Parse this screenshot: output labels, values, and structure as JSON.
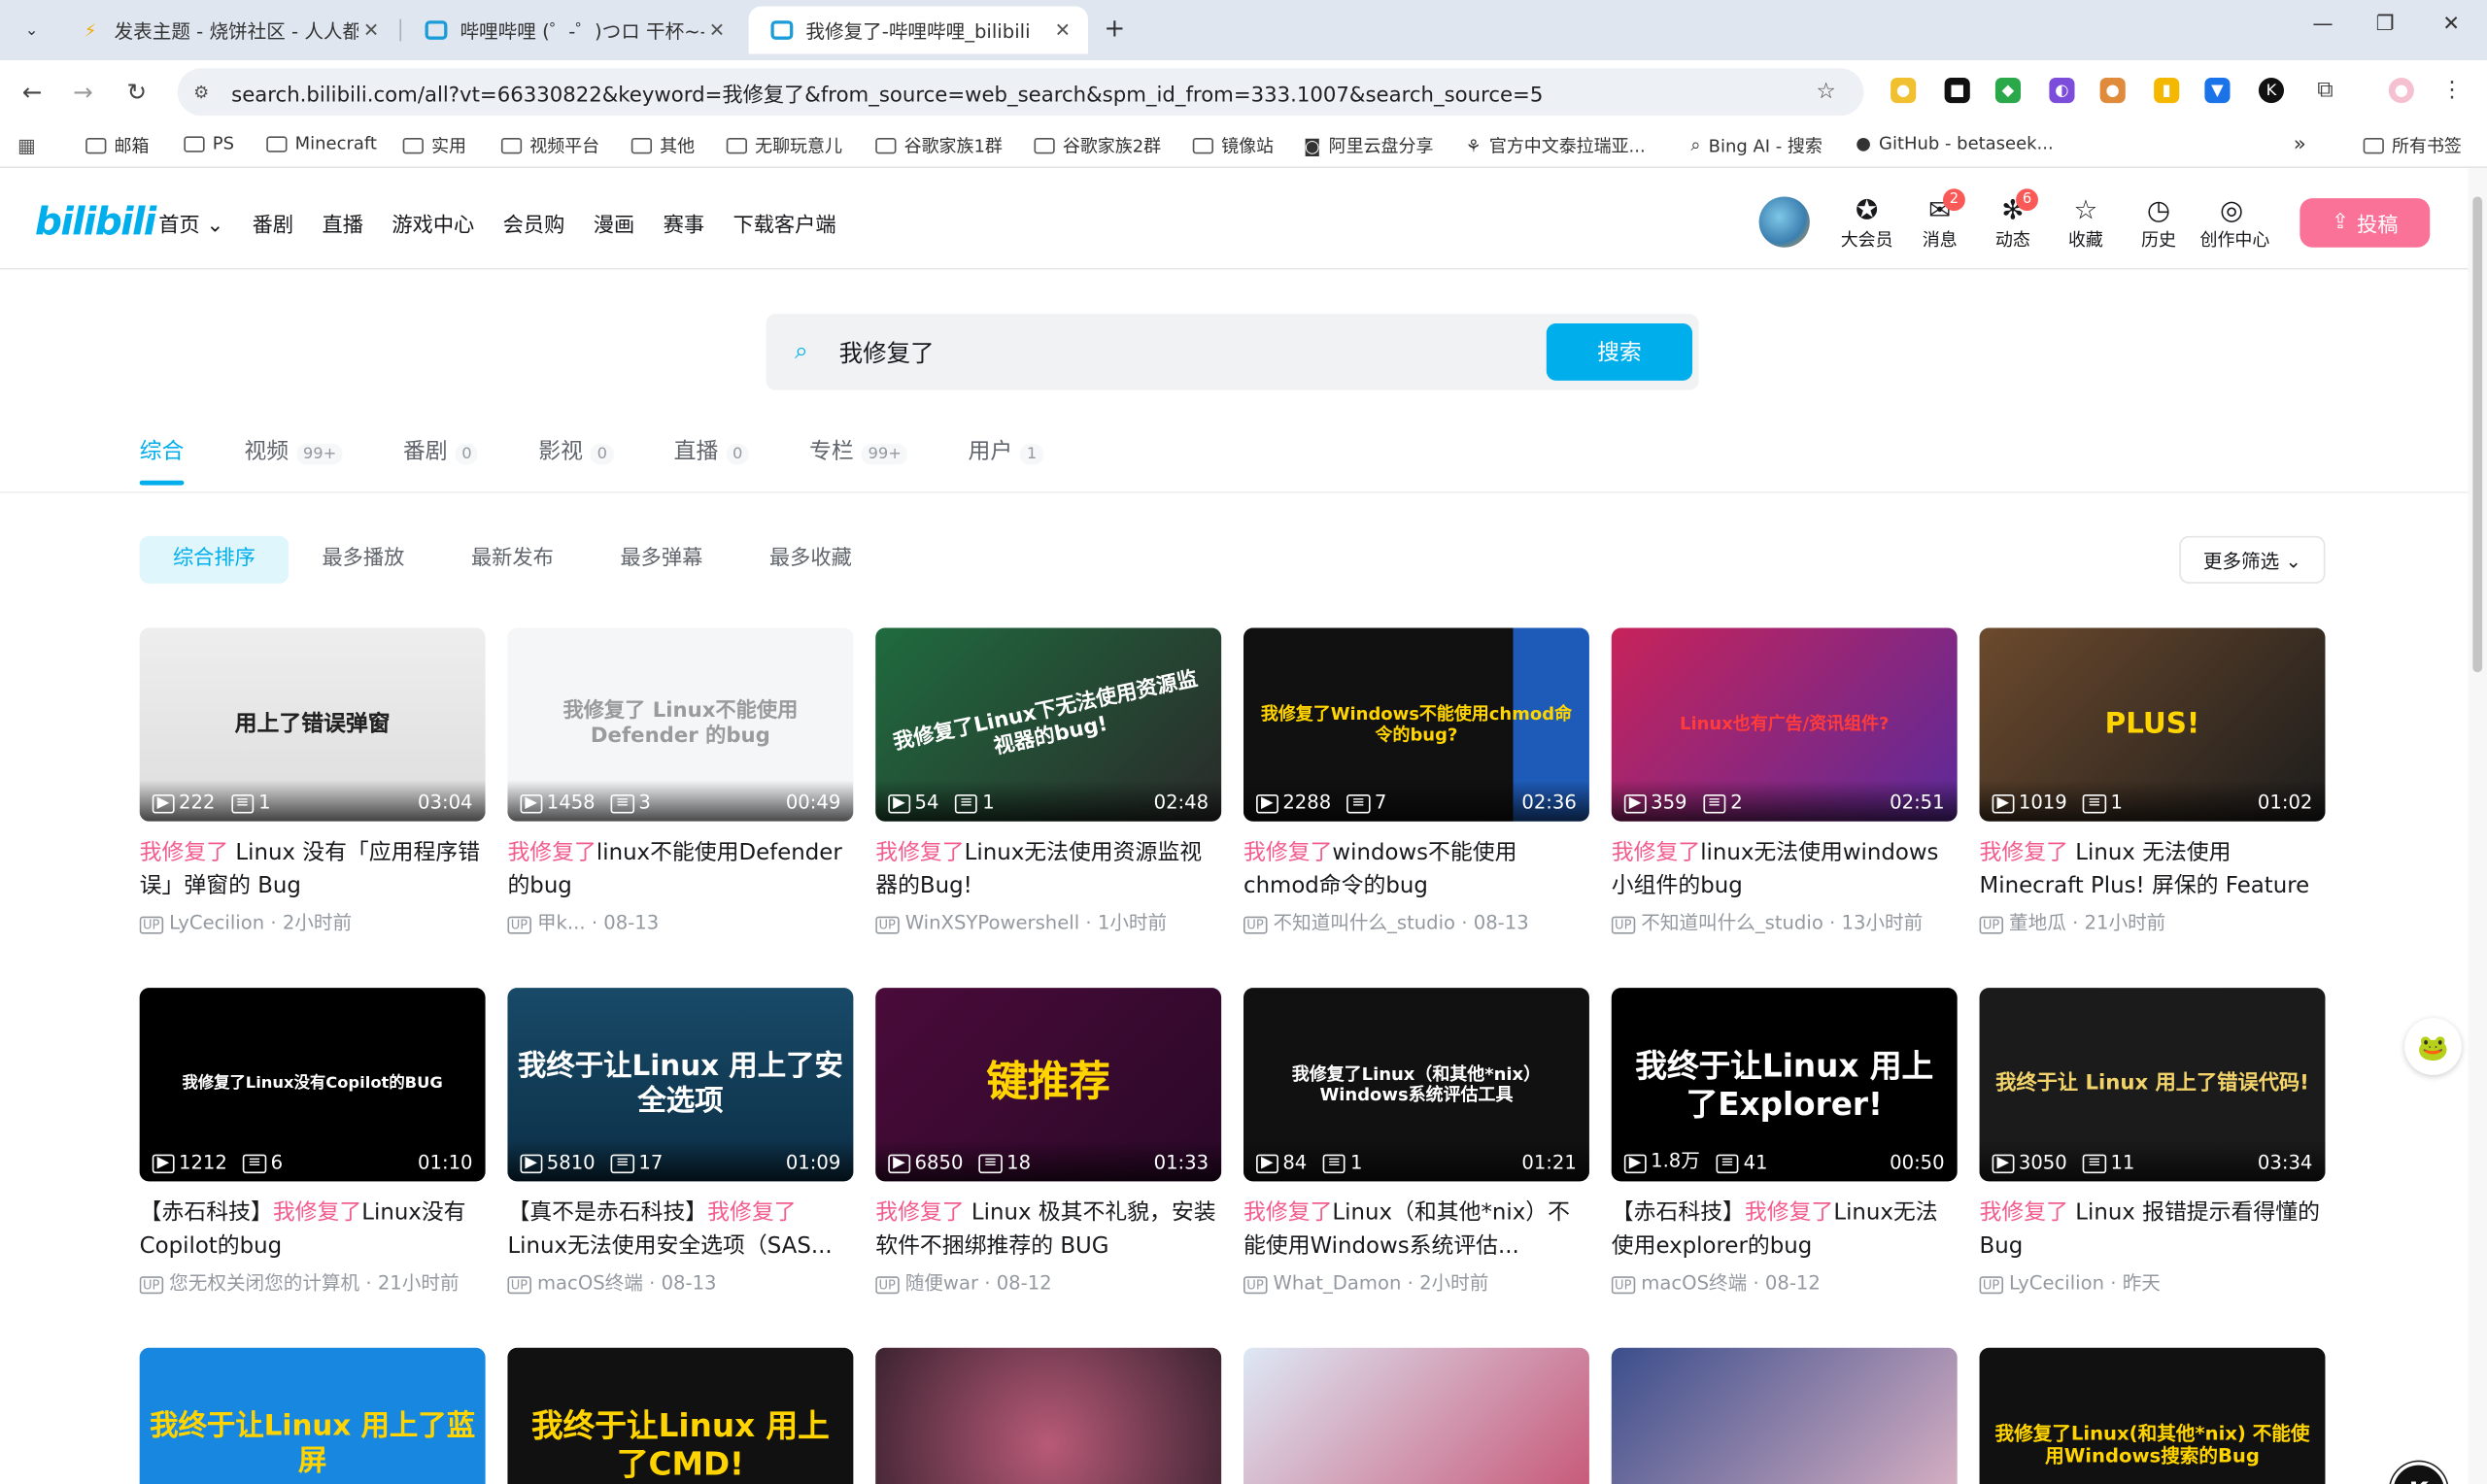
{
  "browser": {
    "tabs": [
      {
        "title": "发表主题 - 烧饼社区 - 人人都有",
        "favicon": "bolt-icon"
      },
      {
        "title": "哔哩哔哩 (゜-゜)つロ 干杯~-bil",
        "favicon": "bilibili-tv-icon"
      },
      {
        "title": "我修复了-哔哩哔哩_bilibili",
        "favicon": "bilibili-tv-icon"
      }
    ],
    "url": "search.bilibili.com/all?vt=66330822&keyword=我修复了&from_source=web_search&spm_id_from=333.1007&search_source=5",
    "bookmarks": [
      "邮箱",
      "PS",
      "Minecraft",
      "实用",
      "视频平台",
      "其他",
      "无聊玩意儿",
      "谷歌家族1群",
      "谷歌家族2群",
      "镜像站",
      "阿里云盘分享",
      "官方中文泰拉瑞亚...",
      "Bing AI - 搜索",
      "GitHub - betaseek..."
    ],
    "all_bookmarks": "所有书签"
  },
  "header": {
    "logo": "bilibili",
    "nav": [
      "首页 ⌄",
      "番剧",
      "直播",
      "游戏中心",
      "会员购",
      "漫画",
      "赛事",
      "下载客户端"
    ],
    "icons": [
      {
        "label": "大会员",
        "badge": ""
      },
      {
        "label": "消息",
        "badge": "2"
      },
      {
        "label": "动态",
        "badge": "6"
      },
      {
        "label": "收藏",
        "badge": ""
      },
      {
        "label": "历史",
        "badge": ""
      },
      {
        "label": "创作中心",
        "badge": ""
      }
    ],
    "upload": "投稿"
  },
  "search": {
    "value": "我修复了",
    "button": "搜索"
  },
  "type_tabs": [
    {
      "label": "综合",
      "count": ""
    },
    {
      "label": "视频",
      "count": "99+"
    },
    {
      "label": "番剧",
      "count": "0"
    },
    {
      "label": "影视",
      "count": "0"
    },
    {
      "label": "直播",
      "count": "0"
    },
    {
      "label": "专栏",
      "count": "99+"
    },
    {
      "label": "用户",
      "count": "1"
    }
  ],
  "sort": [
    "综合排序",
    "最多播放",
    "最新发布",
    "最多弹幕",
    "最多收藏"
  ],
  "more_filter": "更多筛选 ⌄",
  "videos": [
    {
      "caption": "用上了错误弹窗",
      "plays": "222",
      "danmaku": "1",
      "duration": "03:04",
      "prefix": "",
      "hl": "我修复了",
      "rest": " Linux 没有「应用程序错误」弹窗的 Bug",
      "author": "LyCecilion",
      "date": "2小时前"
    },
    {
      "caption": "我修复了 Linux不能使用Defender 的bug",
      "plays": "1458",
      "danmaku": "3",
      "duration": "00:49",
      "prefix": "",
      "hl": "我修复了",
      "rest": "linux不能使用Defender的bug",
      "author": "甲k...",
      "date": "08-13"
    },
    {
      "caption": "我修复了Linux下无法使用资源监视器的bug!",
      "plays": "54",
      "danmaku": "1",
      "duration": "02:48",
      "prefix": "",
      "hl": "我修复了",
      "rest": "Linux无法使用资源监视器的Bug!",
      "author": "WinXSYPowershell",
      "date": "1小时前"
    },
    {
      "caption": "我修复了Windows不能使用chmod命令的bug?",
      "plays": "2288",
      "danmaku": "7",
      "duration": "02:36",
      "prefix": "",
      "hl": "我修复了",
      "rest": "windows不能使用chmod命令的bug",
      "author": "不知道叫什么_studio",
      "date": "08-13"
    },
    {
      "caption": "Linux也有广告/资讯组件?",
      "plays": "359",
      "danmaku": "2",
      "duration": "02:51",
      "prefix": "",
      "hl": "我修复了",
      "rest": "linux无法使用windows小组件的bug",
      "author": "不知道叫什么_studio",
      "date": "13小时前"
    },
    {
      "caption": "PLUS!",
      "plays": "1019",
      "danmaku": "1",
      "duration": "01:02",
      "prefix": "",
      "hl": "我修复了",
      "rest": " Linux 无法使用 Minecraft Plus! 屏保的 Feature",
      "author": "董地瓜",
      "date": "21小时前"
    },
    {
      "caption": "我修复了Linux没有Copilot的BUG",
      "plays": "1212",
      "danmaku": "6",
      "duration": "01:10",
      "prefix": "【赤石科技】",
      "hl": "我修复了",
      "rest": "Linux没有Copilot的bug",
      "author": "您无权关闭您的计算机",
      "date": "21小时前"
    },
    {
      "caption": "我终于让Linux 用上了安全选项",
      "plays": "5810",
      "danmaku": "17",
      "duration": "01:09",
      "prefix": "【真不是赤石科技】",
      "hl": "我修复了",
      "rest": "Linux无法使用安全选项（SAS...",
      "author": "macOS终端",
      "date": "08-13"
    },
    {
      "caption": "键推荐",
      "plays": "6850",
      "danmaku": "18",
      "duration": "01:33",
      "prefix": "",
      "hl": "我修复了",
      "rest": " Linux 极其不礼貌，安装软件不捆绑推荐的 BUG",
      "author": "随便war",
      "date": "08-12"
    },
    {
      "caption": "我修复了Linux（和其他*nix） Windows系统评估工具",
      "plays": "84",
      "danmaku": "1",
      "duration": "01:21",
      "prefix": "",
      "hl": "我修复了",
      "rest": "Linux（和其他*nix）不能使用Windows系统评估...",
      "author": "What_Damon",
      "date": "2小时前"
    },
    {
      "caption": "我终于让Linux 用上了Explorer!",
      "plays": "1.8万",
      "danmaku": "41",
      "duration": "00:50",
      "prefix": "【赤石科技】",
      "hl": "我修复了",
      "rest": "Linux无法使用explorer的bug",
      "author": "macOS终端",
      "date": "08-12"
    },
    {
      "caption": "我终于让 Linux 用上了错误代码!",
      "plays": "3050",
      "danmaku": "11",
      "duration": "03:34",
      "prefix": "",
      "hl": "我修复了",
      "rest": " Linux 报错提示看得懂的 Bug",
      "author": "LyCecilion",
      "date": "昨天"
    },
    {
      "caption": "我终于让Linux 用上了蓝屏",
      "plays": "",
      "danmaku": "",
      "duration": "",
      "prefix": "",
      "hl": "",
      "rest": "",
      "author": "",
      "date": ""
    },
    {
      "caption": "我终于让Linux 用上了CMD!",
      "plays": "",
      "danmaku": "",
      "duration": "",
      "prefix": "",
      "hl": "",
      "rest": "",
      "author": "",
      "date": ""
    },
    {
      "caption": "",
      "plays": "",
      "danmaku": "",
      "duration": "",
      "prefix": "",
      "hl": "",
      "rest": "",
      "author": "",
      "date": ""
    },
    {
      "caption": "",
      "plays": "",
      "danmaku": "",
      "duration": "",
      "prefix": "",
      "hl": "",
      "rest": "",
      "author": "",
      "date": ""
    },
    {
      "caption": "",
      "plays": "",
      "danmaku": "",
      "duration": "",
      "prefix": "",
      "hl": "",
      "rest": "",
      "author": "",
      "date": ""
    },
    {
      "caption": "我修复了Linux(和其他*nix) 不能使用Windows搜索的Bug",
      "plays": "",
      "danmaku": "",
      "duration": "",
      "prefix": "",
      "hl": "",
      "rest": "",
      "author": "",
      "date": ""
    }
  ],
  "colors": {
    "accent": "#00aeec",
    "highlight": "#f25d8e",
    "upload": "#fb7299"
  }
}
